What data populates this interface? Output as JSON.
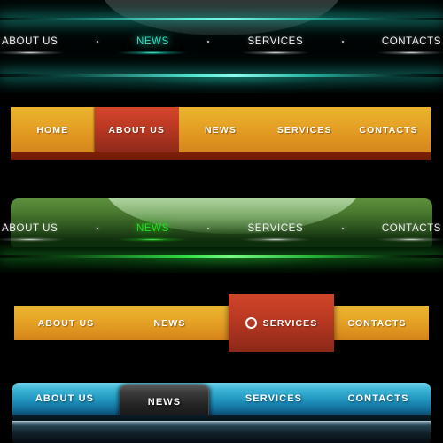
{
  "page": {
    "title": "Navigation Bar Design Set",
    "background_color": "#000000"
  },
  "navbars": [
    {
      "id": "nav-dark-teal",
      "style": "dark-teal-glow",
      "accent_color": "#2ee0c4",
      "active_item": "NEWS",
      "separator": "·",
      "items": [
        {
          "label": "ABOUT US",
          "active": false
        },
        {
          "label": "NEWS",
          "active": true
        },
        {
          "label": "SERVICES",
          "active": false
        },
        {
          "label": "CONTACTS",
          "active": false
        }
      ]
    },
    {
      "id": "nav-orange-tabs",
      "style": "orange-gradient-tabs",
      "accent_color": "#e8a929",
      "active_color": "#bf3a24",
      "footer_color": "#7e2008",
      "active_item": "ABOUT US",
      "items": [
        {
          "label": "HOME",
          "active": false
        },
        {
          "label": "ABOUT US",
          "active": true
        },
        {
          "label": "NEWS",
          "active": false
        },
        {
          "label": "SERVICES",
          "active": false
        },
        {
          "label": "CONTACTS",
          "active": false
        }
      ]
    },
    {
      "id": "nav-green-glossy",
      "style": "green-glossy-glow",
      "accent_color": "#24e024",
      "active_item": "NEWS",
      "separator": "·",
      "items": [
        {
          "label": "ABOUT US",
          "active": false
        },
        {
          "label": "NEWS",
          "active": true
        },
        {
          "label": "SERVICES",
          "active": false
        },
        {
          "label": "CONTACTS",
          "active": false
        }
      ]
    },
    {
      "id": "nav-orange-raised-tab",
      "style": "orange-bar-raised-red-tab",
      "accent_color": "#e8a929",
      "active_color": "#bd3a23",
      "active_item": "SERVICES",
      "active_icon": "circle-ring-icon",
      "items": [
        {
          "label": "ABOUT US",
          "active": false
        },
        {
          "label": "NEWS",
          "active": false
        },
        {
          "label": "SERVICES",
          "active": true
        },
        {
          "label": "CONTACTS",
          "active": false
        }
      ]
    },
    {
      "id": "nav-blue-dark-tab",
      "style": "blue-gradient-dark-active-tab",
      "accent_color": "#1f93bd",
      "active_color": "#242424",
      "active_item": "NEWS",
      "items": [
        {
          "label": "ABOUT US",
          "active": false
        },
        {
          "label": "NEWS",
          "active": true
        },
        {
          "label": "SERVICES",
          "active": false
        },
        {
          "label": "CONTACTS",
          "active": false
        }
      ]
    }
  ]
}
